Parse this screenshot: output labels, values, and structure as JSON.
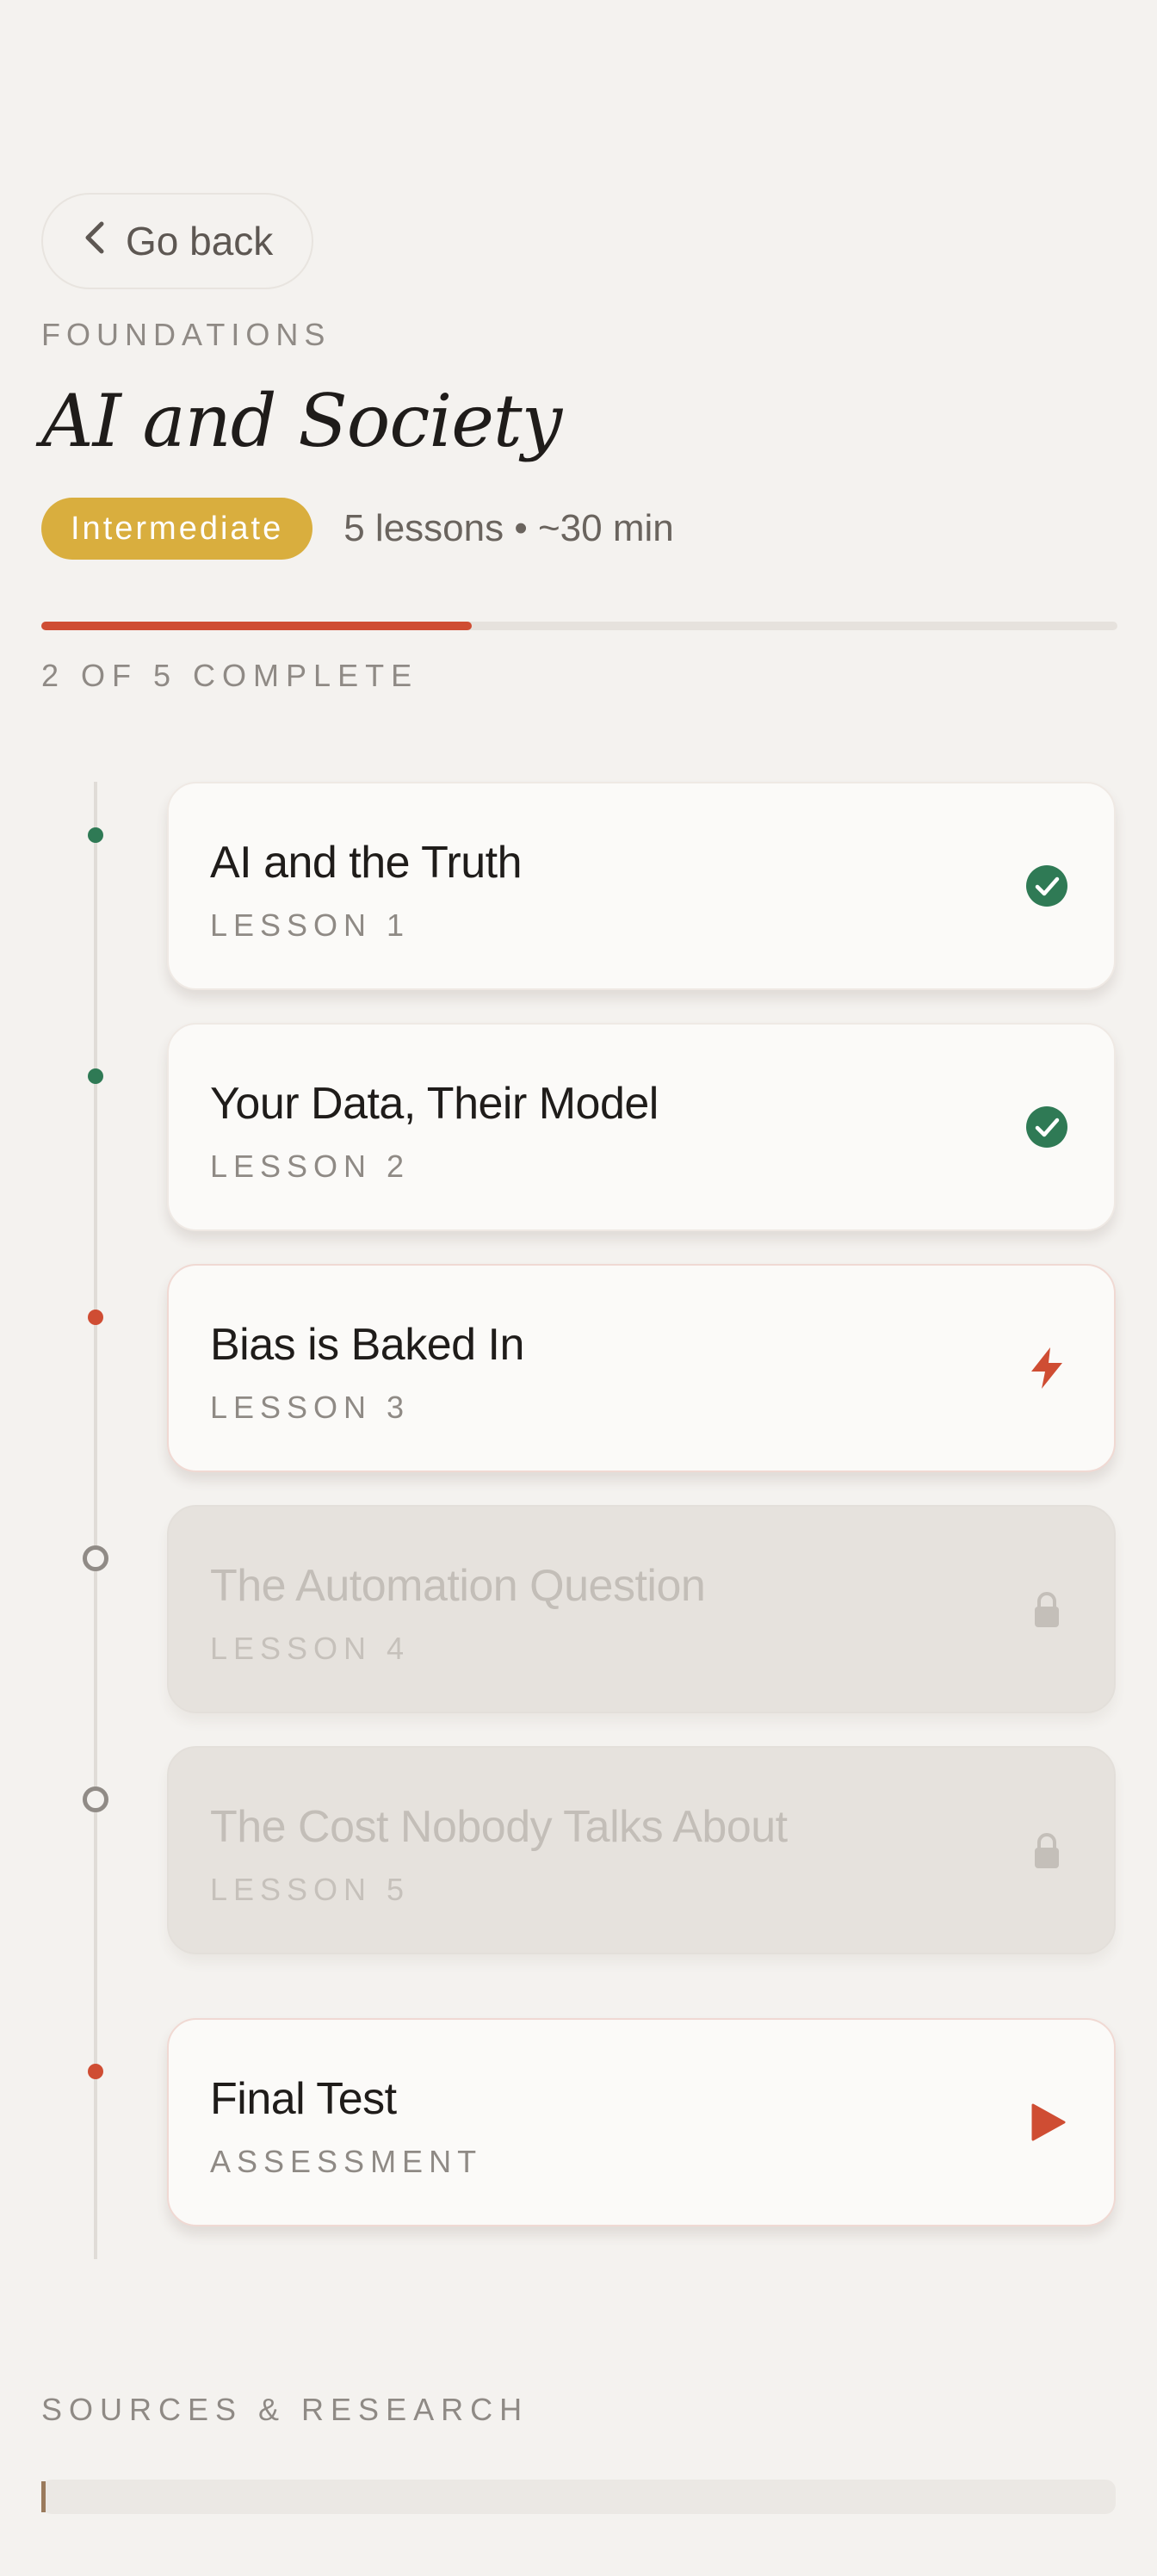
{
  "back": {
    "label": "Go back"
  },
  "course": {
    "category": "FOUNDATIONS",
    "title": "AI and Society",
    "level": "Intermediate",
    "meta": "5 lessons • ~30 min"
  },
  "progress": {
    "completed": 2,
    "total": 5,
    "fraction": 0.4,
    "label": "2 OF 5 COMPLETE"
  },
  "lessons": [
    {
      "title": "AI and the Truth",
      "subtitle": "LESSON 1",
      "status": "done",
      "icon": "check-circle-icon"
    },
    {
      "title": "Your Data, Their Model",
      "subtitle": "LESSON 2",
      "status": "done",
      "icon": "check-circle-icon"
    },
    {
      "title": "Bias is Baked In",
      "subtitle": "LESSON 3",
      "status": "current",
      "icon": "lightning-icon"
    },
    {
      "title": "The Automation Question",
      "subtitle": "LESSON 4",
      "status": "locked",
      "icon": "lock-icon"
    },
    {
      "title": "The Cost Nobody Talks About",
      "subtitle": "LESSON 5",
      "status": "locked",
      "icon": "lock-icon"
    }
  ],
  "final_test": {
    "title": "Final Test",
    "subtitle": "ASSESSMENT",
    "icon": "play-icon"
  },
  "sources": {
    "title": "SOURCES & RESEARCH"
  },
  "colors": {
    "accent": "#cf4d33",
    "done": "#2f7a55",
    "level_badge": "#d9ae3e",
    "background": "#f4f2ef"
  }
}
